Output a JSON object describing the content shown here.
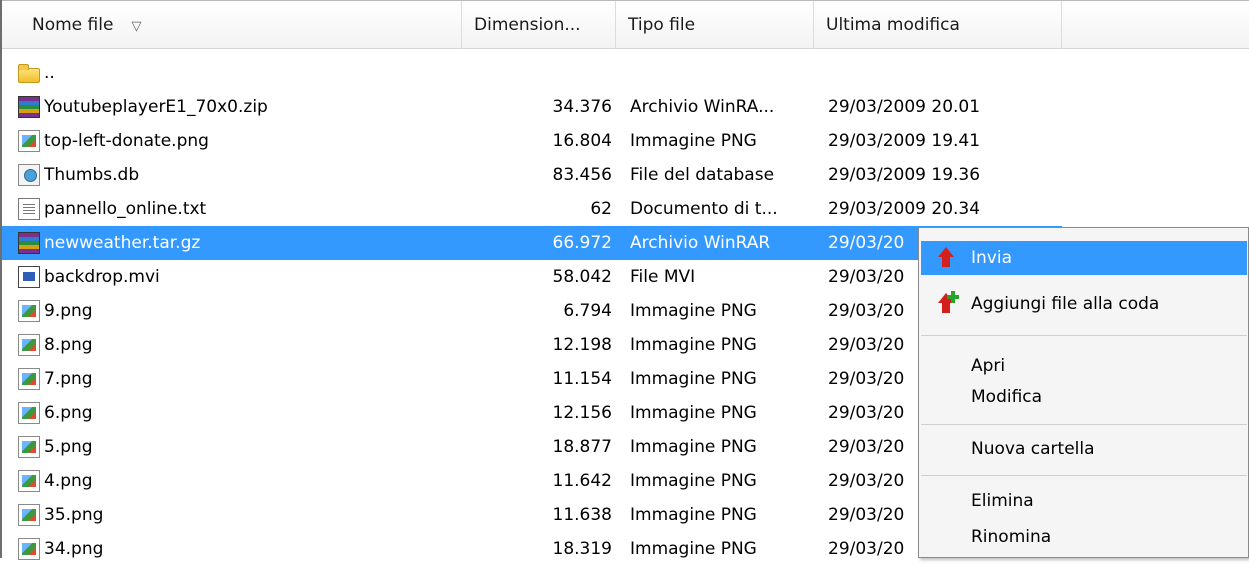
{
  "columns": {
    "name": "Nome file",
    "size": "Dimension...",
    "type": "Tipo file",
    "modified": "Ultima modifica"
  },
  "sort_glyph": "▽",
  "parent_dir": "..",
  "files": [
    {
      "name": "YoutubeplayerE1_70x0.zip",
      "size": "34.376",
      "type": "Archivio WinRA...",
      "modified": "29/03/2009 20.01",
      "icon": "winrar-archive-icon"
    },
    {
      "name": "top-left-donate.png",
      "size": "16.804",
      "type": "Immagine PNG",
      "modified": "29/03/2009 19.41",
      "icon": "png-image-icon"
    },
    {
      "name": "Thumbs.db",
      "size": "83.456",
      "type": "File del database",
      "modified": "29/03/2009 19.36",
      "icon": "database-file-icon"
    },
    {
      "name": "pannello_online.txt",
      "size": "62",
      "type": "Documento di t...",
      "modified": "29/03/2009 20.34",
      "icon": "text-document-icon"
    },
    {
      "name": "newweather.tar.gz",
      "size": "66.972",
      "type": "Archivio WinRAR",
      "modified": "29/03/20",
      "icon": "winrar-archive-icon",
      "selected": true
    },
    {
      "name": "backdrop.mvi",
      "size": "58.042",
      "type": "File MVI",
      "modified": "29/03/20",
      "icon": "mvi-file-icon"
    },
    {
      "name": "9.png",
      "size": "6.794",
      "type": "Immagine PNG",
      "modified": "29/03/20",
      "icon": "png-image-icon"
    },
    {
      "name": "8.png",
      "size": "12.198",
      "type": "Immagine PNG",
      "modified": "29/03/20",
      "icon": "png-image-icon"
    },
    {
      "name": "7.png",
      "size": "11.154",
      "type": "Immagine PNG",
      "modified": "29/03/20",
      "icon": "png-image-icon"
    },
    {
      "name": "6.png",
      "size": "12.156",
      "type": "Immagine PNG",
      "modified": "29/03/20",
      "icon": "png-image-icon"
    },
    {
      "name": "5.png",
      "size": "18.877",
      "type": "Immagine PNG",
      "modified": "29/03/20",
      "icon": "png-image-icon"
    },
    {
      "name": "4.png",
      "size": "11.642",
      "type": "Immagine PNG",
      "modified": "29/03/20",
      "icon": "png-image-icon"
    },
    {
      "name": "35.png",
      "size": "11.638",
      "type": "Immagine PNG",
      "modified": "29/03/20",
      "icon": "png-image-icon"
    },
    {
      "name": "34.png",
      "size": "18.319",
      "type": "Immagine PNG",
      "modified": "29/03/20",
      "icon": "png-image-icon"
    }
  ],
  "context_menu": {
    "send": "Invia",
    "add_to_queue": "Aggiungi file alla coda",
    "open": "Apri",
    "edit": "Modifica",
    "new_folder": "Nuova cartella",
    "delete": "Elimina",
    "rename": "Rinomina"
  },
  "colors": {
    "selection": "#3399ff",
    "menu_background": "#f5f5f5"
  }
}
